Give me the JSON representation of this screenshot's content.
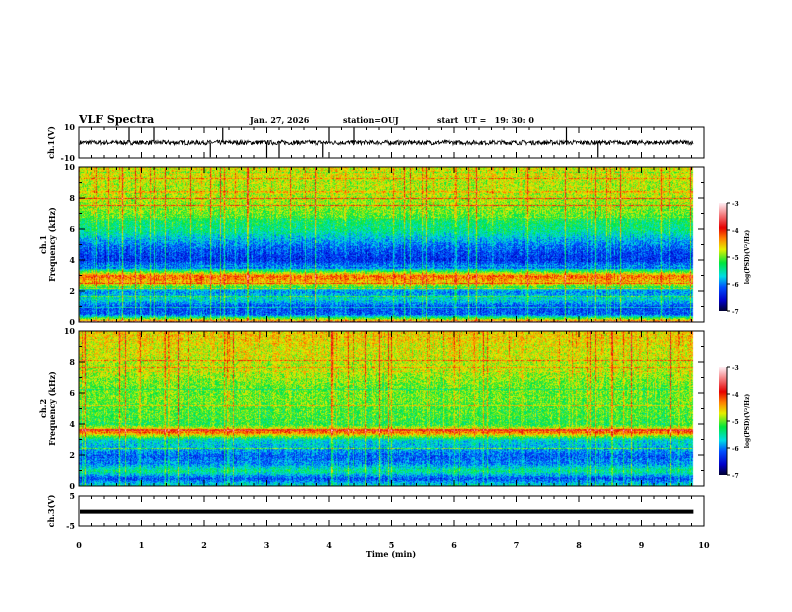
{
  "header": {
    "title": "VLF Spectra",
    "date": "Jan. 27, 2026",
    "station": "station=OUJ",
    "start": "start  UT =   19: 30: 0"
  },
  "chart_data": [
    {
      "type": "line",
      "ylabel": "ch.1(V)",
      "ylim": [
        -10,
        10
      ],
      "yticks": [
        "10",
        "-10"
      ],
      "xlim": [
        0,
        10
      ],
      "trace": {
        "baseline": 0,
        "noise_amplitude": 1.5,
        "spike_times": [
          0.8,
          1.2,
          2.1,
          2.3,
          3.0,
          3.2,
          3.9,
          4.0,
          4.4,
          7.8,
          8.3
        ]
      }
    },
    {
      "type": "heatmap",
      "ylabel": "ch.1\nFrequency (kHz)",
      "ylim": [
        0,
        10
      ],
      "yticks": [
        "0",
        "2",
        "4",
        "6",
        "8",
        "10"
      ],
      "xlim": [
        0,
        10
      ],
      "data_end_min": 9.83,
      "frequency_khz": [
        0,
        0.5,
        1,
        1.5,
        2,
        2.5,
        3,
        3.5,
        4,
        4.5,
        5,
        5.5,
        6,
        6.5,
        7,
        7.5,
        8,
        8.5,
        9,
        9.5,
        10
      ],
      "mean_log_psd": [
        -3.9,
        -6.1,
        -6.2,
        -5.6,
        -6.0,
        -4.6,
        -4.2,
        -5.8,
        -6.3,
        -6.2,
        -6.0,
        -5.7,
        -5.4,
        -5.3,
        -5.0,
        -4.9,
        -4.8,
        -4.8,
        -4.8,
        -4.7,
        -4.7
      ],
      "colorbar": {
        "label": "log(PSD)(V²/Hz)",
        "range": [
          -7,
          -3
        ],
        "ticks": [
          "-3",
          "-4",
          "-5",
          "-6",
          "-7"
        ]
      }
    },
    {
      "type": "heatmap",
      "ylabel": "ch.2\nFrequency (kHz)",
      "ylim": [
        0,
        10
      ],
      "yticks": [
        "0",
        "2",
        "4",
        "6",
        "8",
        "10"
      ],
      "xlim": [
        0,
        10
      ],
      "data_end_min": 9.83,
      "frequency_khz": [
        0,
        0.5,
        1,
        1.5,
        2,
        2.5,
        3,
        3.5,
        4,
        4.5,
        5,
        5.5,
        6,
        6.5,
        7,
        7.5,
        8,
        8.5,
        9,
        9.5,
        10
      ],
      "mean_log_psd": [
        -5.5,
        -6.2,
        -5.4,
        -6.0,
        -6.1,
        -5.8,
        -5.6,
        -4.2,
        -5.2,
        -5.1,
        -5.1,
        -5.0,
        -5.0,
        -5.0,
        -4.9,
        -4.8,
        -4.8,
        -4.7,
        -4.7,
        -4.6,
        -4.6
      ],
      "colorbar": {
        "label": "log(PSD)(V²/Hz)",
        "range": [
          -7,
          -3
        ],
        "ticks": [
          "-3",
          "-4",
          "-5",
          "-6",
          "-7"
        ]
      }
    },
    {
      "type": "line",
      "ylabel": "ch.3(V)",
      "ylim": [
        -5,
        5
      ],
      "yticks": [
        "5",
        "-5"
      ],
      "xlim": [
        0,
        10
      ],
      "trace": {
        "baseline": -0.2,
        "noise_amplitude": 0
      }
    }
  ],
  "xaxis": {
    "label": "Time (min)",
    "ticks": [
      "0",
      "1",
      "2",
      "3",
      "4",
      "5",
      "6",
      "7",
      "8",
      "9",
      "10"
    ]
  }
}
